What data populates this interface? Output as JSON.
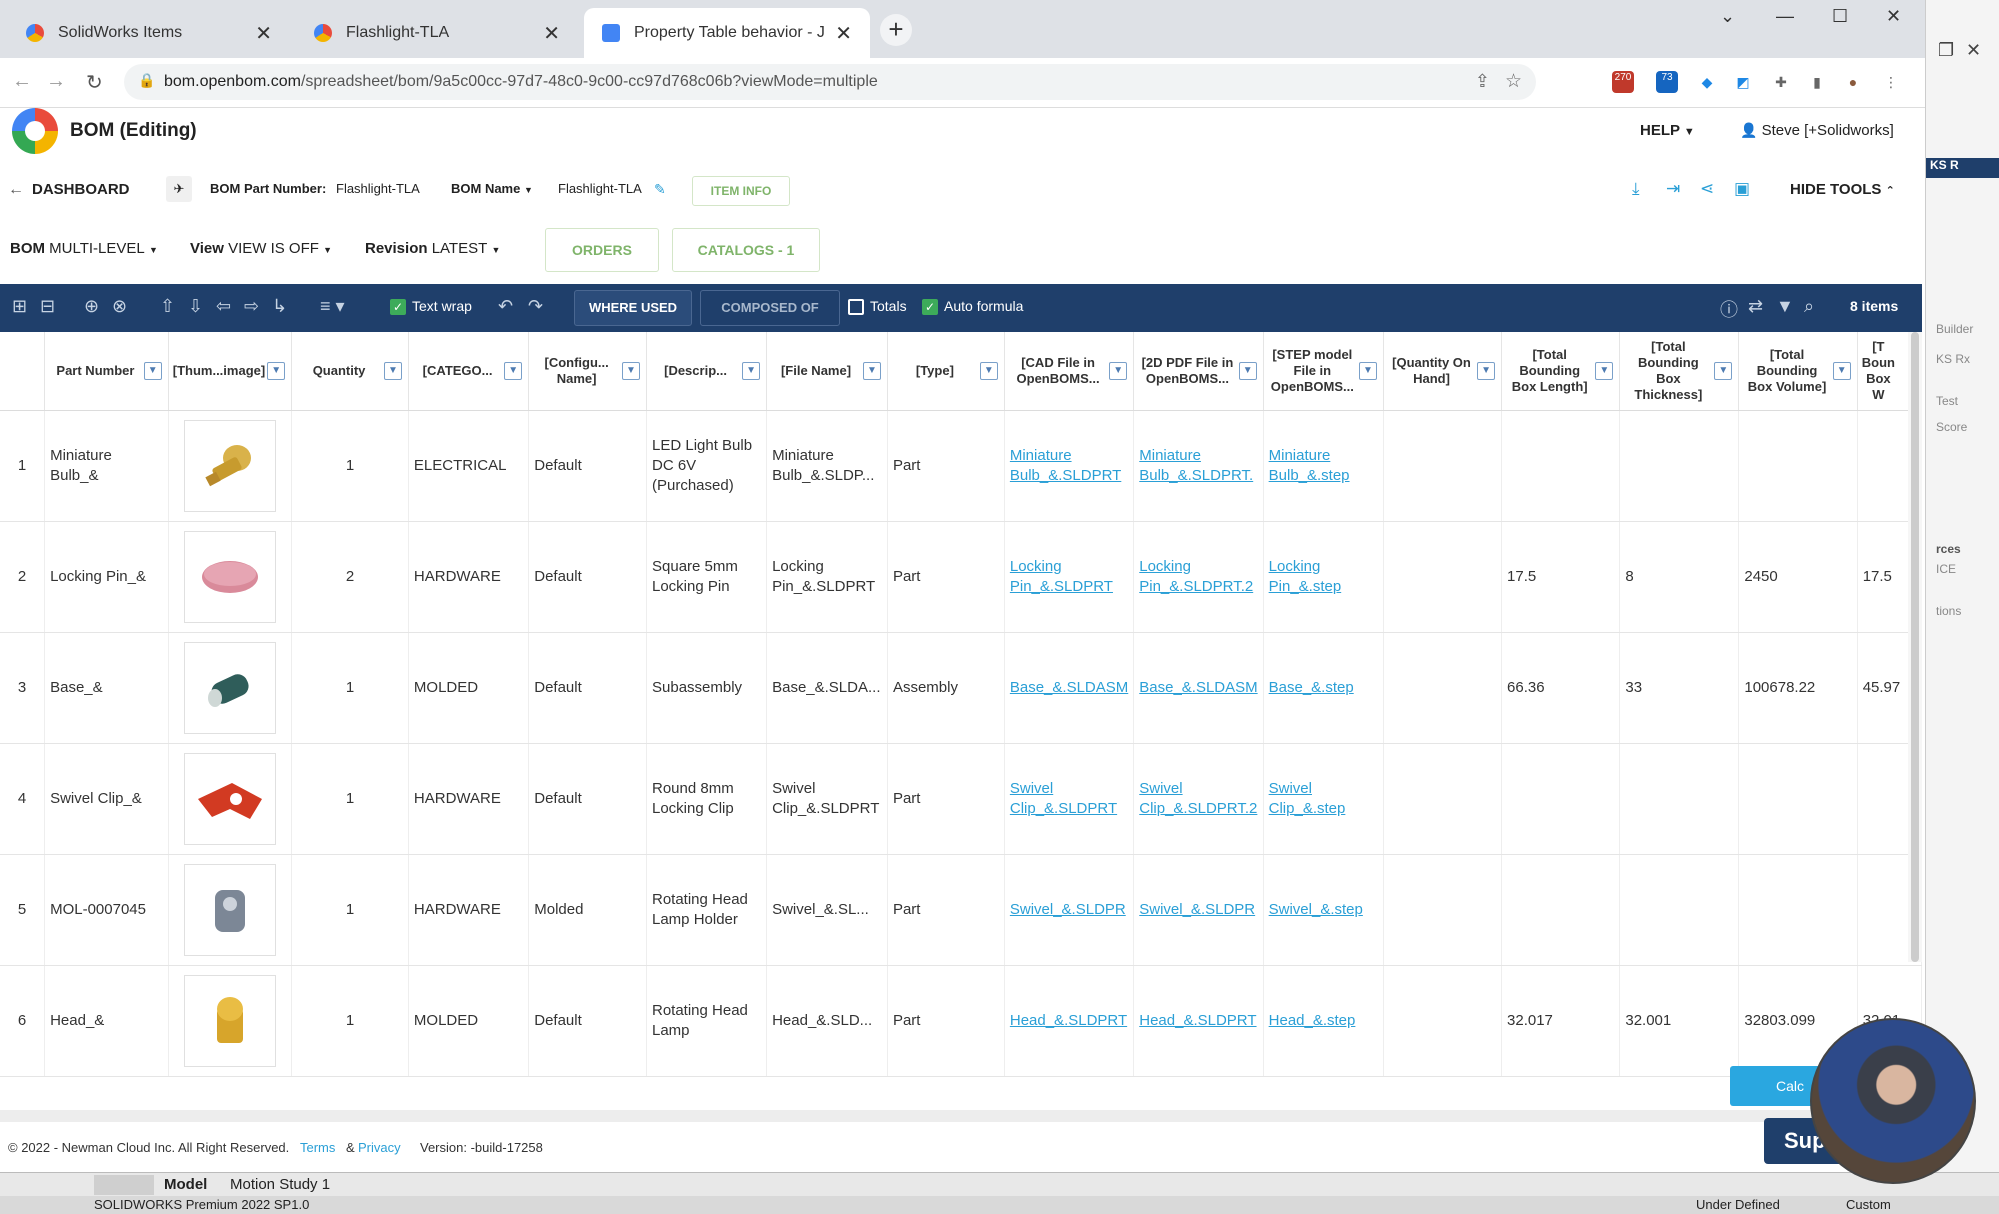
{
  "browser": {
    "tabs": [
      {
        "label": "SolidWorks Items",
        "color": "#e94b3c"
      },
      {
        "label": "Flashlight-TLA",
        "color": "#e94b3c"
      },
      {
        "label": "Property Table behavior - June 2",
        "color": "#4285f4"
      }
    ],
    "url_host": "bom.openbom.com",
    "url_path": "/spreadsheet/bom/9a5c00cc-97d7-48c0-9c00-cc97d768c06b?viewMode=multiple",
    "ext_badge_1": "270",
    "ext_badge_2": "73"
  },
  "side_panel": {
    "items": [
      "KS R",
      "Builder",
      "KS Rx",
      "Test",
      "Score",
      "rces",
      "ICE",
      "tions"
    ]
  },
  "header": {
    "title": "BOM (Editing)",
    "help": "HELP",
    "user": "Steve [+Solidworks]"
  },
  "subheader": {
    "dashboard": "DASHBOARD",
    "part_number_label": "BOM Part Number:",
    "part_number_value": "Flashlight-TLA",
    "name_label": "BOM Name",
    "name_value": "Flashlight-TLA",
    "item_info": "ITEM INFO",
    "hide_tools": "HIDE TOOLS"
  },
  "view_row": {
    "bom_label": "BOM",
    "bom_value": "MULTI-LEVEL",
    "view_label": "View",
    "view_value": "VIEW IS OFF",
    "revision_label": "Revision",
    "revision_value": "LATEST",
    "orders": "ORDERS",
    "catalogs": "CATALOGS - 1"
  },
  "toolbar": {
    "text_wrap": "Text wrap",
    "where_used": "WHERE USED",
    "composed_of": "COMPOSED OF",
    "totals": "Totals",
    "auto_formula": "Auto formula",
    "item_count": "8 items"
  },
  "columns": [
    "Part Number",
    "[Thum...image]",
    "Quantity",
    "[CATEGO...",
    "[Configu... Name]",
    "[Descrip...",
    "[File Name]",
    "[Type]",
    "[CAD File in OpenBOMS...",
    "[2D PDF File in OpenBOMS...",
    "[STEP model File in OpenBOMS...",
    "[Quantity On Hand]",
    "[Total Bounding Box Length]",
    "[Total Bounding Box Thickness]",
    "[Total Bounding Box Volume]",
    "[T Boun Box W"
  ],
  "rows": [
    {
      "n": "1",
      "part": "Miniature Bulb_&",
      "thumb": "bulb",
      "qty": "1",
      "cat": "ELECTRICAL",
      "config": "Default",
      "desc": "LED Light Bulb DC 6V (Purchased)",
      "file": "Miniature Bulb_&.SLDP...",
      "type": "Part",
      "cad": "Miniature Bulb_&.SLDPRT",
      "pdf": "Miniature Bulb_&.SLDPRT.",
      "step": "Miniature Bulb_&.step",
      "qoh": "",
      "len": "",
      "thk": "",
      "vol": "",
      "w": ""
    },
    {
      "n": "2",
      "part": "Locking Pin_&",
      "thumb": "pin",
      "qty": "2",
      "cat": "HARDWARE",
      "config": "Default",
      "desc": "Square 5mm Locking Pin",
      "file": "Locking Pin_&.SLDPRT",
      "type": "Part",
      "cad": "Locking Pin_&.SLDPRT",
      "pdf": "Locking Pin_&.SLDPRT.2",
      "step": "Locking Pin_&.step",
      "qoh": "",
      "len": "17.5",
      "thk": "8",
      "vol": "2450",
      "w": "17.5"
    },
    {
      "n": "3",
      "part": "Base_&",
      "thumb": "base",
      "qty": "1",
      "cat": "MOLDED",
      "config": "Default",
      "desc": "Subassembly",
      "file": "Base_&.SLDA...",
      "type": "Assembly",
      "cad": "Base_&.SLDASM",
      "pdf": "Base_&.SLDASM",
      "step": "Base_&.step",
      "qoh": "",
      "len": "66.36",
      "thk": "33",
      "vol": "100678.22",
      "w": "45.97"
    },
    {
      "n": "4",
      "part": "Swivel Clip_&",
      "thumb": "clip",
      "qty": "1",
      "cat": "HARDWARE",
      "config": "Default",
      "desc": "Round 8mm Locking Clip",
      "file": "Swivel Clip_&.SLDPRT",
      "type": "Part",
      "cad": "Swivel Clip_&.SLDPRT",
      "pdf": "Swivel Clip_&.SLDPRT.2",
      "step": "Swivel Clip_&.step",
      "qoh": "",
      "len": "",
      "thk": "",
      "vol": "",
      "w": ""
    },
    {
      "n": "5",
      "part": "MOL-0007045",
      "thumb": "holder",
      "qty": "1",
      "cat": "HARDWARE",
      "config": "Molded",
      "desc": "Rotating Head Lamp Holder",
      "file": "Swivel_&.SL...",
      "type": "Part",
      "cad": "Swivel_&.SLDPR",
      "pdf": "Swivel_&.SLDPR",
      "step": "Swivel_&.step",
      "qoh": "",
      "len": "",
      "thk": "",
      "vol": "",
      "w": ""
    },
    {
      "n": "6",
      "part": "Head_&",
      "thumb": "head",
      "qty": "1",
      "cat": "MOLDED",
      "config": "Default",
      "desc": "Rotating Head Lamp",
      "file": "Head_&.SLD...",
      "type": "Part",
      "cad": "Head_&.SLDPRT",
      "pdf": "Head_&.SLDPRT",
      "step": "Head_&.step",
      "qoh": "",
      "len": "32.017",
      "thk": "32.001",
      "vol": "32803.099",
      "w": "32.01"
    }
  ],
  "footer": {
    "copyright": "© 2022 - Newman Cloud Inc. All Right Reserved.",
    "terms": "Terms",
    "amp": "&",
    "privacy": "Privacy",
    "version": "Version: -build-17258",
    "calc": "Calc",
    "sup": "Sup"
  },
  "solidworks": {
    "tab_model": "Model",
    "tab_motion": "Motion Study 1",
    "status_left": "SOLIDWORKS Premium 2022 SP1.0",
    "status_mid": "Under Defined",
    "status_right": "Custom"
  },
  "colors": {
    "toolbar": "#1f3f6b",
    "link": "#2a9fd6",
    "accent_green": "#7fb46a"
  }
}
